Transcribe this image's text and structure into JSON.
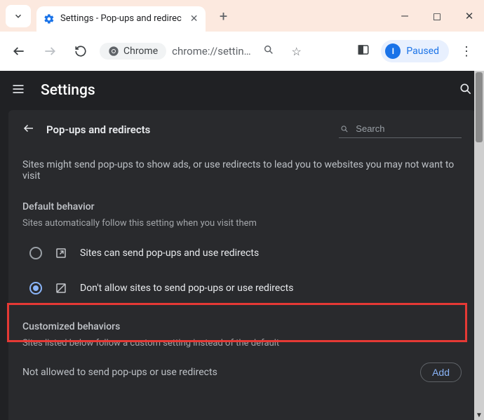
{
  "window": {
    "tab_title": "Settings - Pop-ups and redirec",
    "new_tab_tooltip": "+"
  },
  "toolbar": {
    "chrome_label": "Chrome",
    "url": "chrome://settin…",
    "profile_status": "Paused",
    "profile_initial": "I"
  },
  "app": {
    "title": "Settings"
  },
  "page": {
    "title": "Pop-ups and redirects",
    "search_placeholder": "Search",
    "description": "Sites might send pop-ups to show ads, or use redirects to lead you to websites you may not want to visit",
    "default_behavior_label": "Default behavior",
    "default_behavior_sub": "Sites automatically follow this setting when you visit them",
    "option_allow": "Sites can send pop-ups and use redirects",
    "option_block": "Don't allow sites to send pop-ups or use redirects",
    "customized_label": "Customized behaviors",
    "customized_sub": "Sites listed below follow a custom setting instead of the default",
    "not_allowed_label": "Not allowed to send pop-ups or use redirects",
    "add_button": "Add",
    "selected_option": "block"
  }
}
